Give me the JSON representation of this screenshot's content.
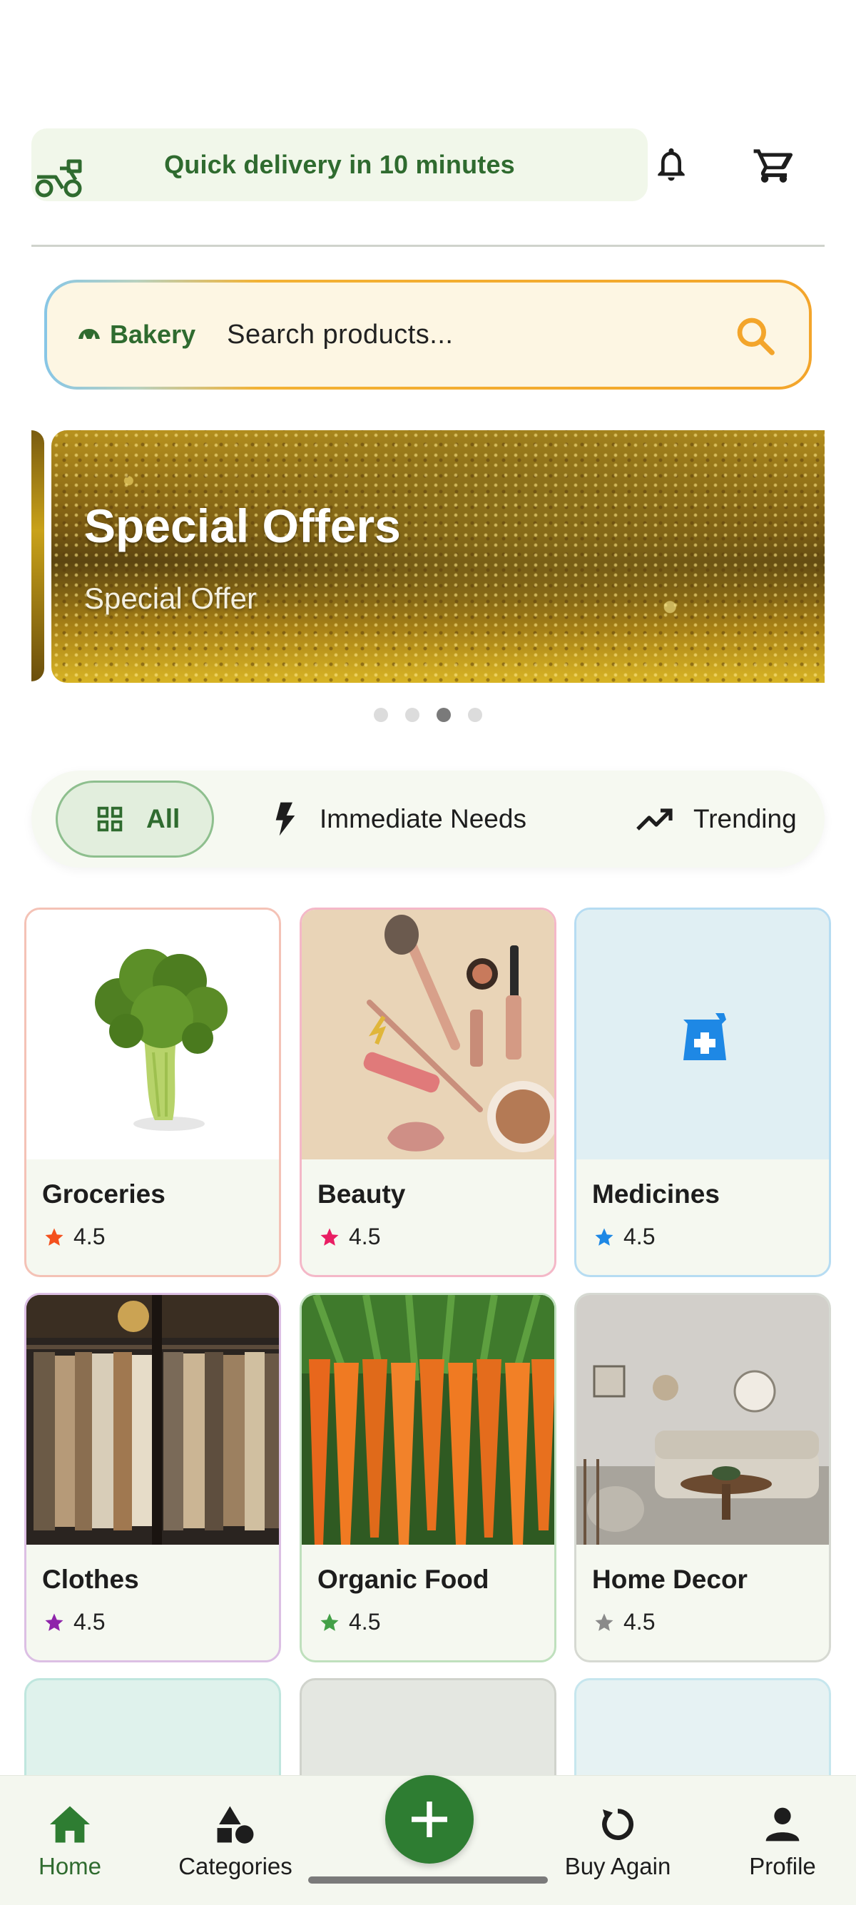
{
  "header": {
    "delivery_text": "Quick delivery in 10 minutes",
    "icons": [
      "scooter-icon",
      "bell-icon",
      "cart-icon"
    ]
  },
  "search": {
    "category_label": "Bakery",
    "category_icon": "bakery-icon",
    "placeholder": "Search products...",
    "accent_color": "#f3a52b"
  },
  "banner": {
    "title": "Special Offers",
    "subtitle": "Special Offer",
    "dots_count": 4,
    "active_dot": 3
  },
  "filters": [
    {
      "label": "All",
      "icon": "grid-icon",
      "active": true
    },
    {
      "label": "Immediate Needs",
      "icon": "lightning-icon",
      "active": false
    },
    {
      "label": "Trending",
      "icon": "trending-icon",
      "active": false
    }
  ],
  "categories": [
    {
      "name": "Groceries",
      "rating": "4.5",
      "star_color": "#f4511e",
      "border": "#f4c2b6"
    },
    {
      "name": "Beauty",
      "rating": "4.5",
      "star_color": "#e91e63",
      "border": "#f4b8c8"
    },
    {
      "name": "Medicines",
      "rating": "4.5",
      "star_color": "#1e88e5",
      "border": "#b6dcf2"
    },
    {
      "name": "Clothes",
      "rating": "4.5",
      "star_color": "#8e24aa",
      "border": "#dcbfe4"
    },
    {
      "name": "Organic Food",
      "rating": "4.5",
      "star_color": "#43a047",
      "border": "#bfe0bd"
    },
    {
      "name": "Home Decor",
      "rating": "4.5",
      "star_color": "#8a8a8a",
      "border": "#d6d9d2"
    }
  ],
  "bottom_nav": {
    "home": "Home",
    "categories": "Categories",
    "buy_again": "Buy Again",
    "profile": "Profile",
    "active": "Home",
    "active_color": "#2e7d32"
  }
}
